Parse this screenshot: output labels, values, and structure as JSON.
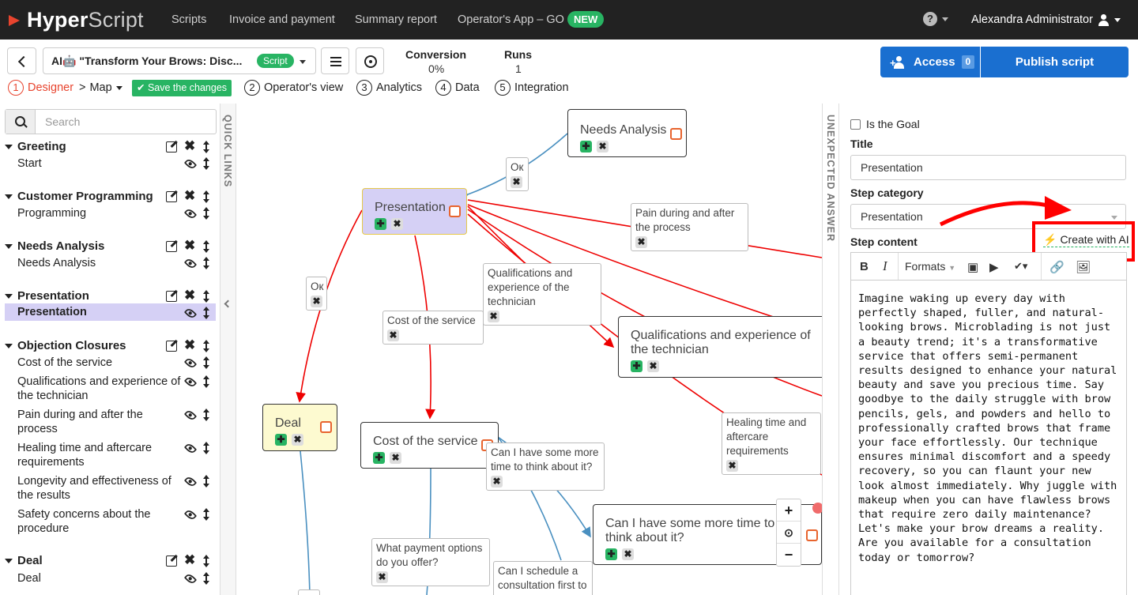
{
  "topbar": {
    "logo_bold": "Hyper",
    "logo_thin": "Script",
    "nav": [
      "Scripts",
      "Invoice and payment",
      "Summary report",
      "Operator's App – GO"
    ],
    "new_badge": "NEW",
    "help": "?",
    "user": "Alexandra Administrator"
  },
  "toolbar": {
    "script_title": "AI🤖 \"Transform Your Brows: Disc...",
    "script_badge": "Script",
    "stats": [
      {
        "label": "Conversion",
        "value": "0%"
      },
      {
        "label": "Runs",
        "value": "1"
      }
    ],
    "access_label": "Access",
    "access_count": "0",
    "publish_label": "Publish script"
  },
  "steps": {
    "designer": {
      "num": "1",
      "label": "Designer"
    },
    "separator": ">",
    "map": "Map",
    "save": "Save the changes",
    "operator_view": {
      "num": "2",
      "label": "Operator's view"
    },
    "analytics": {
      "num": "3",
      "label": "Analytics"
    },
    "data": {
      "num": "4",
      "label": "Data"
    },
    "integration": {
      "num": "5",
      "label": "Integration"
    }
  },
  "sidebar": {
    "search_placeholder": "Search",
    "groups": [
      {
        "title": "Greeting",
        "items": [
          "Start"
        ]
      },
      {
        "title": "Customer Programming",
        "items": [
          "Programming"
        ]
      },
      {
        "title": "Needs Analysis",
        "items": [
          "Needs Analysis"
        ]
      },
      {
        "title": "Presentation",
        "items": [
          "Presentation"
        ]
      },
      {
        "title": "Objection Closures",
        "items": [
          "Cost of the service",
          "Qualifications and experience of the technician",
          "Pain during and after the process",
          "Healing time and aftercare requirements",
          "Longevity and effectiveness of the results",
          "Safety concerns about the procedure"
        ]
      },
      {
        "title": "Deal",
        "items": [
          "Deal"
        ]
      }
    ]
  },
  "quick_links": "QUICK LINKS",
  "unexpected_answer": "UNEXPECTED ANSWER",
  "canvas": {
    "nodes": {
      "needs_analysis": "Needs Analysis",
      "presentation": "Presentation",
      "qualifications": "Qualifications and experience of the technician",
      "deal": "Deal",
      "cost": "Cost of the service",
      "more_time": "Can I have some more time to think about it?"
    },
    "labels": {
      "ok1": "Ок",
      "ok2": "Ок",
      "pain": "Pain during and after the process",
      "qual": "Qualifications and experience of the technician",
      "cost": "Cost of the service",
      "healing": "Healing time and aftercare requirements",
      "more_time": "Can I have some more time to think about it?",
      "payment": "What payment options do you offer?",
      "schedule": "Can I schedule a consultation first to"
    },
    "zoom": [
      "+",
      "⊙",
      "−"
    ]
  },
  "panel": {
    "is_goal": "Is the Goal",
    "title_label": "Title",
    "title_value": "Presentation",
    "category_label": "Step category",
    "category_value": "Presentation",
    "content_label": "Step content",
    "create_ai": "Create with AI",
    "formats": "Formats",
    "content": "Imagine waking up every day with perfectly shaped, fuller, and natural-looking brows. Microblading is not just a beauty trend; it's a transformative service that offers semi-permanent results designed to enhance your natural beauty and save you precious time. Say goodbye to the daily struggle with brow pencils, gels, and powders and hello to professionally crafted brows that frame your face effortlessly. Our technique ensures minimal discomfort and a speedy recovery, so you can flaunt your new look almost immediately. Why juggle with makeup when you can have flawless brows that require zero daily maintenance? Let's make your brow dreams a reality. Are you available for a consultation today or tomorrow?"
  },
  "colors": {
    "accent": "#1a6fd0",
    "green": "#28b463",
    "selected": "#d5d0f5",
    "red": "#e8442e"
  }
}
